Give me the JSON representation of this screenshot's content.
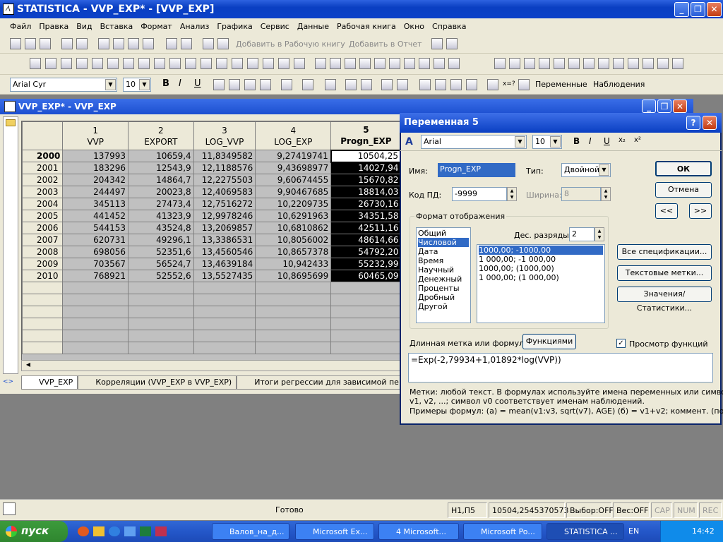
{
  "window": {
    "title": "STATISTICA - VVP_EXP* - [VVP_EXP]"
  },
  "menu": [
    "Файл",
    "Правка",
    "Вид",
    "Вставка",
    "Формат",
    "Анализ",
    "Графика",
    "Сервис",
    "Данные",
    "Рабочая книга",
    "Окно",
    "Справка"
  ],
  "toolbar1": {
    "add_workbook": "Добавить в Рабочую книгу",
    "add_report": "Добавить в Отчет"
  },
  "toolbar3": {
    "font": "Arial Cyr",
    "size": "10",
    "variables": "Переменные",
    "cases": "Наблюдения"
  },
  "workbook": {
    "title": "VVP_EXP* - VVP_EXP",
    "columns": [
      {
        "num": "1",
        "name": "VVP"
      },
      {
        "num": "2",
        "name": "EXPORT"
      },
      {
        "num": "3",
        "name": "LOG_VVP"
      },
      {
        "num": "4",
        "name": "LOG_EXP"
      },
      {
        "num": "5",
        "name": "Progn_EXP"
      }
    ],
    "rows": [
      [
        "2000",
        "137993",
        "10659,4",
        "11,8349582",
        "9,27419741",
        "10504,25"
      ],
      [
        "2001",
        "183296",
        "12543,9",
        "12,1188576",
        "9,43698977",
        "14027,94"
      ],
      [
        "2002",
        "204342",
        "14864,7",
        "12,2275503",
        "9,60674455",
        "15670,82"
      ],
      [
        "2003",
        "244497",
        "20023,8",
        "12,4069583",
        "9,90467685",
        "18814,03"
      ],
      [
        "2004",
        "345113",
        "27473,4",
        "12,7516272",
        "10,2209735",
        "26730,16"
      ],
      [
        "2005",
        "441452",
        "41323,9",
        "12,9978246",
        "10,6291963",
        "34351,58"
      ],
      [
        "2006",
        "544153",
        "43524,8",
        "13,2069857",
        "10,6810862",
        "42511,16"
      ],
      [
        "2007",
        "620731",
        "49296,1",
        "13,3386531",
        "10,8056002",
        "48614,66"
      ],
      [
        "2008",
        "698056",
        "52351,6",
        "13,4560546",
        "10,8657378",
        "54792,20"
      ],
      [
        "2009",
        "703567",
        "56524,7",
        "13,4639184",
        "10,942433",
        "55232,99"
      ],
      [
        "2010",
        "768921",
        "52552,6",
        "13,5527435",
        "10,8695699",
        "60465,09"
      ]
    ],
    "tabs": [
      "VVP_EXP",
      "Корреляции (VVP_EXP в VVP_EXP)",
      "Итоги регрессии для зависимой перемен"
    ]
  },
  "dialog": {
    "title": "Переменная 5",
    "font": "Arial",
    "size": "10",
    "name_label": "Имя:",
    "name_value": "Progn_EXP",
    "type_label": "Тип:",
    "type_value": "Двойной",
    "md_label": "Код ПД:",
    "md_value": "-9999",
    "width_label": "Ширина:",
    "width_value": "8",
    "ok": "ОК",
    "cancel": "Отмена",
    "prev": "<<",
    "next": ">>",
    "format_group": "Формат отображения",
    "formats": [
      "Общий",
      "Числовой",
      "Дата",
      "Время",
      "Научный",
      "Денежный",
      "Проценты",
      "Дробный",
      "Другой"
    ],
    "decimals_label": "Дес. разряды:",
    "decimals_value": "2",
    "number_formats": [
      "1000,00; -1000,00",
      "1 000,00; -1 000,00",
      "1000,00; (1000,00)",
      "1 000,00; (1 000,00)"
    ],
    "all_specs": "Все спецификации...",
    "text_labels": "Текстовые метки...",
    "values_stats": "Значения/Статистики...",
    "long_label": "Длинная метка или формула с",
    "functions": "Функциями",
    "preview": "Просмотр функций",
    "formula": "=Exp(-2,79934+1,01892*log(VVP))",
    "help1": "Метки: любой текст.    В формулах используйте имена переменных или символы",
    "help2": "v1, v2, ...; символ v0 соответствует именам наблюдений.",
    "help3": "Примеры формул:   (а) = mean(v1:v3, sqrt(v7), AGE)   (б) = v1+v2; коммент. (после;)"
  },
  "status": {
    "ready": "Готово",
    "cell": "Н1,П5",
    "value": "10504,2545370573",
    "sel": "Выбор:OFF",
    "weight": "Вес:OFF",
    "cap": "CAP",
    "num": "NUM",
    "rec": "REC"
  },
  "taskbar": {
    "start": "пуск",
    "tasks": [
      "Валов_на_д...",
      "Microsoft Ex...",
      "4 Microsoft...",
      "Microsoft Po...",
      "STATISTICA ..."
    ],
    "lang": "EN",
    "time": "14:42"
  }
}
